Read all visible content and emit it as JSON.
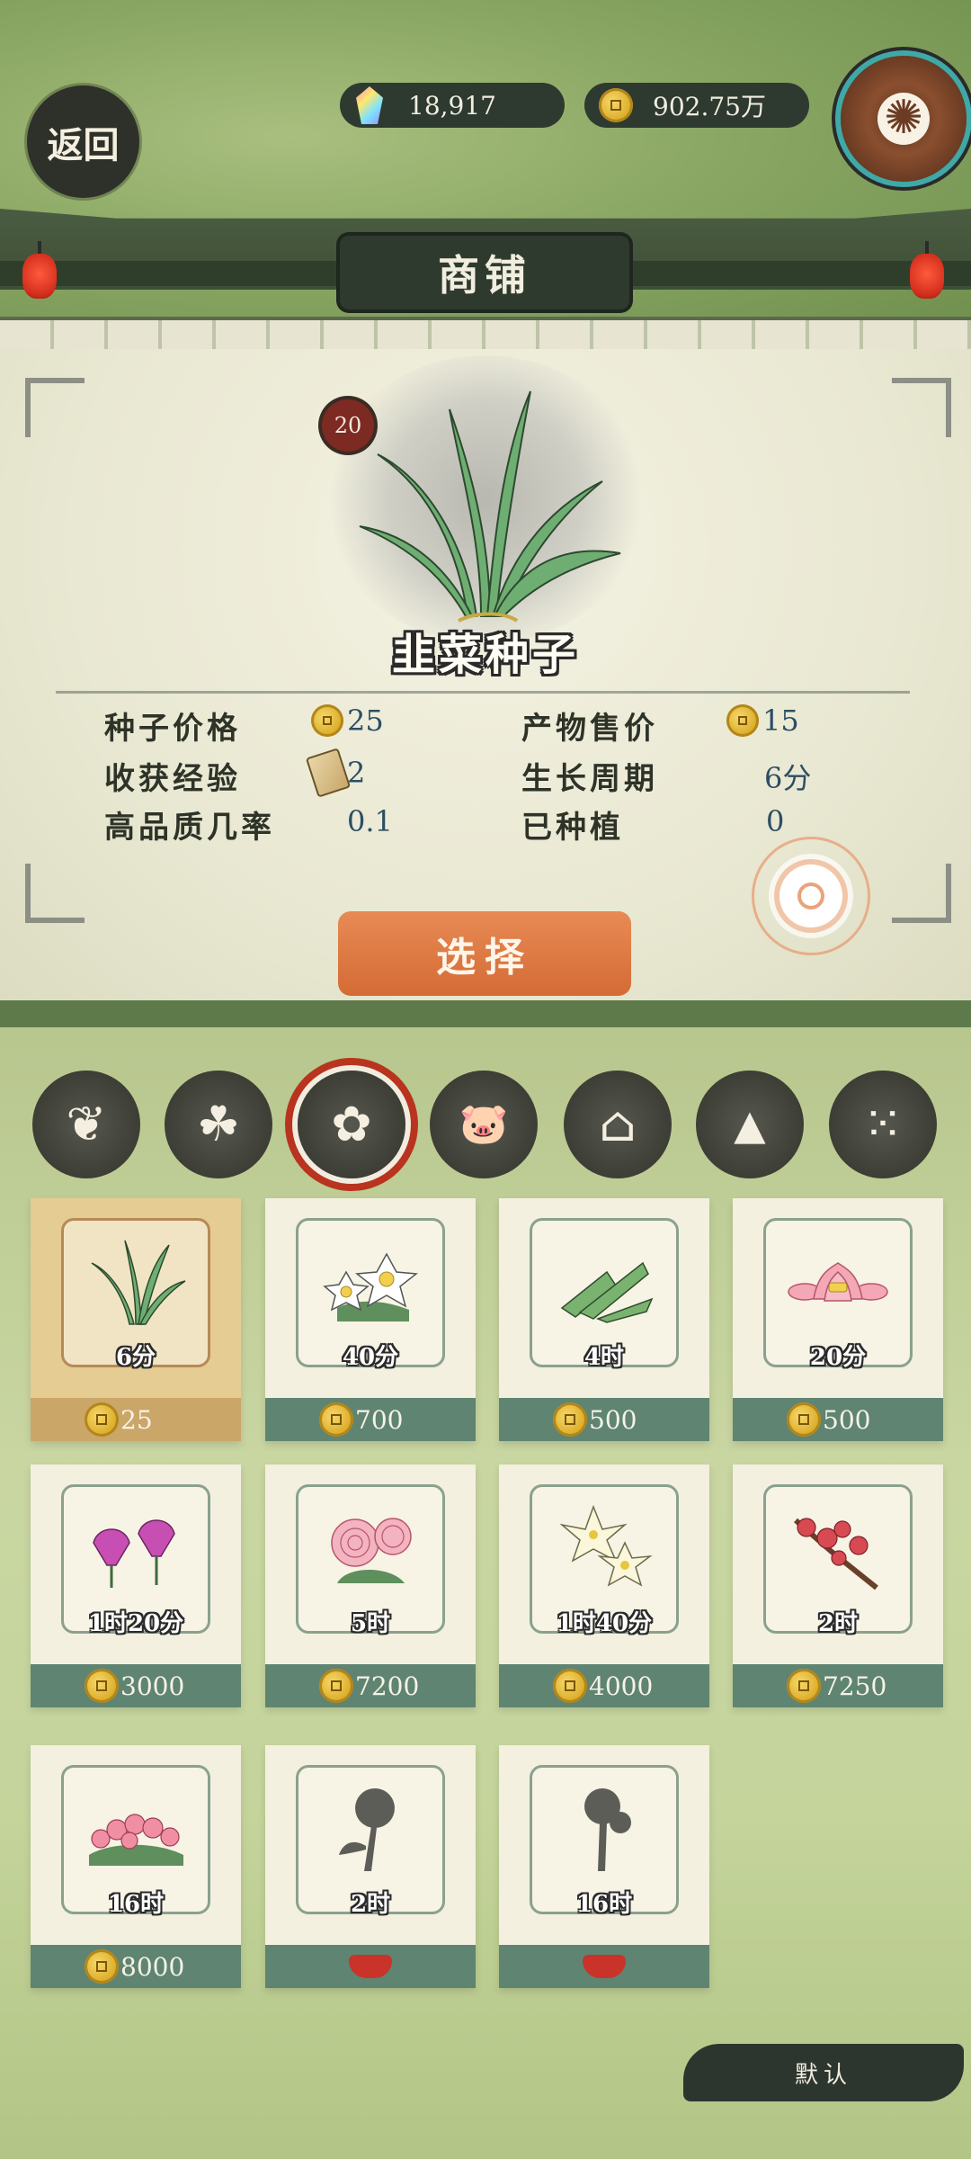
{
  "header": {
    "back_label": "返回",
    "gems": "18,917",
    "coins": "902.75万",
    "title": "商铺"
  },
  "selected_item": {
    "level": "20",
    "name": "韭菜种子",
    "stats": [
      {
        "label": "种子价格",
        "value": "25",
        "icon": "coin-icon"
      },
      {
        "label": "产物售价",
        "value": "15",
        "icon": "coin-icon"
      },
      {
        "label": "收获经验",
        "value": "2",
        "icon": "scroll-icon"
      },
      {
        "label": "生长周期",
        "value": "6分",
        "icon": ""
      },
      {
        "label": "高品质几率",
        "value": "0.1",
        "icon": ""
      },
      {
        "label": "已种植",
        "value": "0",
        "icon": ""
      }
    ],
    "select_label": "选择"
  },
  "categories": [
    {
      "name": "vegetable-icon",
      "glyph": "❦",
      "selected": false
    },
    {
      "name": "herb-icon",
      "glyph": "☘",
      "selected": false
    },
    {
      "name": "flower-icon",
      "glyph": "✿",
      "selected": true
    },
    {
      "name": "pig-icon",
      "glyph": "🐷",
      "selected": false
    },
    {
      "name": "house-icon",
      "glyph": "⌂",
      "selected": false
    },
    {
      "name": "rock-icon",
      "glyph": "▲",
      "selected": false
    },
    {
      "name": "pebbles-icon",
      "glyph": "⁙",
      "selected": false
    }
  ],
  "seeds": [
    {
      "time": "6分",
      "price": "25",
      "locked": false,
      "selected": true,
      "art": "chive"
    },
    {
      "time": "40分",
      "price": "700",
      "locked": false,
      "selected": false,
      "art": "daffodil"
    },
    {
      "time": "4时",
      "price": "500",
      "locked": false,
      "selected": false,
      "art": "aloe"
    },
    {
      "time": "20分",
      "price": "500",
      "locked": false,
      "selected": false,
      "art": "lotus"
    },
    {
      "time": "1时20分",
      "price": "3000",
      "locked": false,
      "selected": false,
      "art": "morning-glory"
    },
    {
      "time": "5时",
      "price": "7200",
      "locked": false,
      "selected": false,
      "art": "peony"
    },
    {
      "time": "1时40分",
      "price": "4000",
      "locked": false,
      "selected": false,
      "art": "lily"
    },
    {
      "time": "2时",
      "price": "7250",
      "locked": false,
      "selected": false,
      "art": "plum-blossom"
    },
    {
      "time": "16时",
      "price": "8000",
      "locked": false,
      "selected": false,
      "art": "azalea"
    },
    {
      "time": "2时",
      "price": "",
      "locked": true,
      "selected": false,
      "art": "chrysanthemum"
    },
    {
      "time": "16时",
      "price": "",
      "locked": true,
      "selected": false,
      "art": "rose"
    }
  ],
  "sort_label": "默认",
  "colors": {
    "accent_orange": "#d46b35",
    "price_bar": "#5f8472",
    "selected_ring": "#b8341f"
  }
}
